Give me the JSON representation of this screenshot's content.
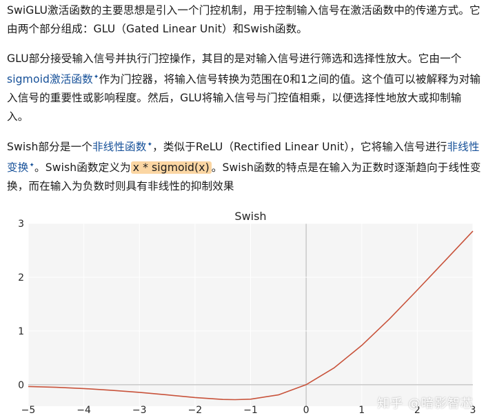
{
  "paragraphs": {
    "p1": "SwiGLU激活函数的主要思想是引入一个门控机制，用于控制输入信号在激活函数中的传递方式。它由两个部分组成：GLU（Gated Linear Unit）和Swish函数。",
    "p2_before": "GLU部分接受输入信号并执行门控操作，其目的是对输入信号进行筛选和选择性放大。它由一个",
    "p2_link": "sigmoid激活函数",
    "p2_after": "作为门控器，将输入信号转换为范围在0和1之间的值。这个值可以被解释为对输入信号的重要性或影响程度。然后，GLU将输入信号与门控值相乘，以便选择性地放大或抑制输入。",
    "p3_a": "Swish部分是一个",
    "p3_link1": "非线性函数",
    "p3_b": "，类似于ReLU（Rectified Linear Unit），它将输入信号进行",
    "p3_link2": "非线性变换",
    "p3_c": "。Swish函数定义为",
    "p3_code": "x * sigmoid(x)",
    "p3_d": "。Swish函数的特点是在输入为正数时逐渐趋向于线性变换，而在输入为负数时则具有非线性的抑制效果"
  },
  "link_marker": "✦",
  "watermark": "知乎 @暗影智芯",
  "colors": {
    "link": "#175199",
    "highlight": "#fbd6a3",
    "curve": "#c8523a",
    "plot_bg": "#f5f5f5"
  },
  "chart_data": {
    "type": "line",
    "title": "Swish",
    "function": "x * sigmoid(x)",
    "xlim": [
      -5,
      3
    ],
    "ylim": [
      -0.4,
      3
    ],
    "xticks": [
      -5,
      -4,
      -3,
      -2,
      -1,
      0,
      1,
      2,
      3
    ],
    "yticks": [
      0,
      1,
      2,
      3
    ],
    "grid": true,
    "series": [
      {
        "x": [
          -5,
          -4.5,
          -4,
          -3.5,
          -3,
          -2.5,
          -2,
          -1.5,
          -1.28,
          -1,
          -0.5,
          0,
          0.5,
          1,
          1.5,
          2,
          2.5,
          3
        ],
        "values": [
          -0.033,
          -0.049,
          -0.072,
          -0.103,
          -0.142,
          -0.189,
          -0.238,
          -0.274,
          -0.278,
          -0.269,
          -0.189,
          0,
          0.311,
          0.731,
          1.226,
          1.762,
          2.308,
          2.858
        ]
      }
    ]
  }
}
